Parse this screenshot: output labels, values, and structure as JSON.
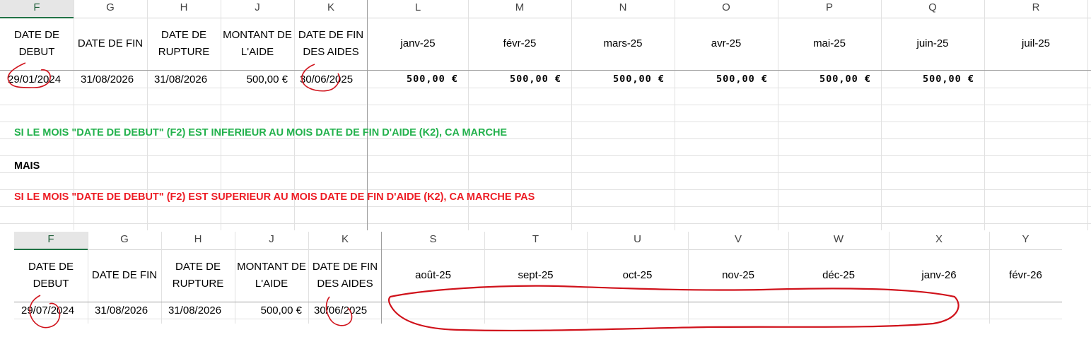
{
  "colors": {
    "green_note": "#22b14c",
    "red_note": "#ed1c24",
    "annotation": "#d0121b",
    "selected_header": "#217346"
  },
  "sheet1": {
    "col_letters": [
      "F",
      "G",
      "H",
      "J",
      "K",
      "L",
      "M",
      "N",
      "O",
      "P",
      "Q",
      "R"
    ],
    "headers": [
      "DATE DE DEBUT",
      "DATE DE FIN",
      "DATE DE RUPTURE",
      "MONTANT DE L'AIDE",
      "DATE DE FIN DES AIDES",
      "janv-25",
      "févr-25",
      "mars-25",
      "avr-25",
      "mai-25",
      "juin-25",
      "juil-25"
    ],
    "row": {
      "debut": "29/01/2024",
      "fin": "31/08/2026",
      "rupture": "31/08/2026",
      "montant": "500,00 €",
      "fin_aides": "30/06/2025"
    },
    "months_values": [
      "500,00 €",
      "500,00 €",
      "500,00 €",
      "500,00 €",
      "500,00 €",
      "500,00 €"
    ],
    "notes": {
      "green": "SI LE MOIS \"DATE DE DEBUT\" (F2)  EST INFERIEUR AU MOIS DATE DE FIN D'AIDE (K2), CA MARCHE",
      "mais": "MAIS",
      "red": "SI LE MOIS \"DATE DE DEBUT\" (F2)  EST  SUPERIEUR AU MOIS DATE DE FIN D'AIDE (K2), CA MARCHE  PAS"
    }
  },
  "sheet2": {
    "col_letters": [
      "F",
      "G",
      "H",
      "J",
      "K",
      "S",
      "T",
      "U",
      "V",
      "W",
      "X",
      "Y"
    ],
    "headers": [
      "DATE DE DEBUT",
      "DATE DE FIN",
      "DATE DE RUPTURE",
      "MONTANT DE L'AIDE",
      "DATE DE FIN DES AIDES",
      "août-25",
      "sept-25",
      "oct-25",
      "nov-25",
      "déc-25",
      "janv-26",
      "févr-26"
    ],
    "row": {
      "debut": "29/07/2024",
      "fin": "31/08/2026",
      "rupture": "31/08/2026",
      "montant": "500,00 €",
      "fin_aides": "30/06/2025"
    }
  }
}
